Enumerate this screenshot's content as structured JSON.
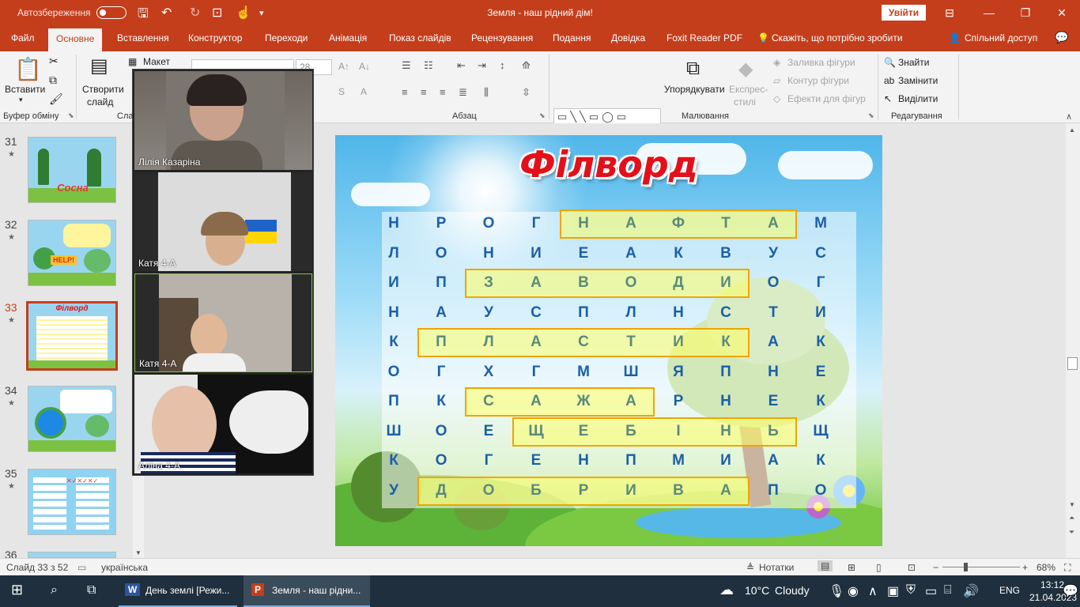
{
  "titlebar": {
    "autosave_label": "Автозбереження",
    "doc_title": "Земля - наш рідний дім!",
    "signin": "Увійти"
  },
  "tabs": [
    "Файл",
    "Основне",
    "Вставлення",
    "Конструктор",
    "Переходи",
    "Анімація",
    "Показ слайдів",
    "Рецензування",
    "Подання",
    "Довідка",
    "Foxit Reader PDF"
  ],
  "tell_me": "Скажіть, що потрібно зробити",
  "share": "Спільний доступ",
  "ribbon": {
    "paste": "Вставити",
    "new_slide_1": "Створити",
    "new_slide_2": "слайд",
    "layout": "Макет",
    "font_size": "28",
    "arrange": "Упорядкувати",
    "quick_styles_1": "Експрес-",
    "quick_styles_2": "стилі",
    "fill": "Заливка фігури",
    "outline": "Контур фігури",
    "effects": "Ефекти для фігур",
    "find": "Знайти",
    "replace": "Замінити",
    "select": "Виділити",
    "groups": {
      "clipboard": "Буфер обміну",
      "slides": "Сла",
      "paragraph": "Абзац",
      "drawing": "Малювання",
      "editing": "Редагування"
    }
  },
  "thumbnails": [
    {
      "num": "31",
      "title": "Сосна"
    },
    {
      "num": "32",
      "title": "HELP!"
    },
    {
      "num": "33",
      "title": "Філворд"
    },
    {
      "num": "34",
      "title": ""
    },
    {
      "num": "35",
      "title": ""
    },
    {
      "num": "36",
      "title": ""
    }
  ],
  "video": [
    {
      "name": "Лілія Казаріна"
    },
    {
      "name": "Катя  4-А"
    },
    {
      "name": "Катя 4-А"
    },
    {
      "name": "Аліна 4-А"
    }
  ],
  "slide": {
    "title": "Філворд",
    "grid": [
      [
        "Н",
        "Р",
        "О",
        "Г",
        "Н",
        "А",
        "Ф",
        "Т",
        "А",
        "М"
      ],
      [
        "Л",
        "О",
        "Н",
        "И",
        "Е",
        "А",
        "К",
        "В",
        "У",
        "С"
      ],
      [
        "И",
        "П",
        "З",
        "А",
        "В",
        "О",
        "Д",
        "И",
        "О",
        "Г"
      ],
      [
        "Н",
        "А",
        "У",
        "С",
        "П",
        "Л",
        "Н",
        "С",
        "Т",
        "И"
      ],
      [
        "К",
        "П",
        "Л",
        "А",
        "С",
        "Т",
        "И",
        "К",
        "А",
        "К"
      ],
      [
        "О",
        "Г",
        "Х",
        "Г",
        "М",
        "Ш",
        "Я",
        "П",
        "Н",
        "Е"
      ],
      [
        "П",
        "К",
        "С",
        "А",
        "Ж",
        "А",
        "Р",
        "Н",
        "Е",
        "К"
      ],
      [
        "Ш",
        "О",
        "Е",
        "Щ",
        "Е",
        "Б",
        "І",
        "Н",
        "Ь",
        "Щ"
      ],
      [
        "К",
        "О",
        "Г",
        "Е",
        "Н",
        "П",
        "М",
        "И",
        "А",
        "К"
      ],
      [
        "У",
        "Д",
        "О",
        "Б",
        "Р",
        "И",
        "В",
        "А",
        "П",
        "О"
      ]
    ],
    "highlights": [
      {
        "row": 0,
        "from": 4,
        "to": 8
      },
      {
        "row": 2,
        "from": 2,
        "to": 7
      },
      {
        "row": 4,
        "from": 1,
        "to": 7
      },
      {
        "row": 6,
        "from": 2,
        "to": 5
      },
      {
        "row": 7,
        "from": 3,
        "to": 8
      },
      {
        "row": 9,
        "from": 1,
        "to": 7
      }
    ]
  },
  "status": {
    "slide_info": "Слайд 33 з 52",
    "language": "українська",
    "notes": "Нотатки",
    "zoom": "68%"
  },
  "taskbar": {
    "app1": "День землі [Режи...",
    "app2": "Земля - наш рідни...",
    "weather_temp": "10°C",
    "weather_desc": "Cloudy",
    "lang": "ENG",
    "time": "13:12",
    "date": "21.04.2023"
  }
}
